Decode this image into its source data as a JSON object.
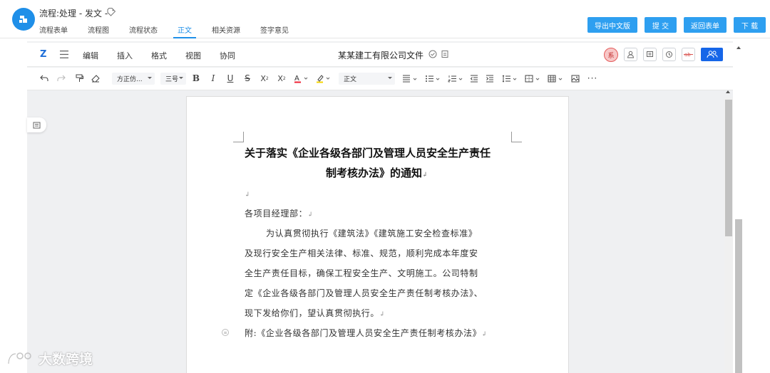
{
  "app": {
    "title": "流程:处理 - 发文 -",
    "tabs": [
      {
        "label": "流程表单",
        "active": false
      },
      {
        "label": "流程图",
        "active": false
      },
      {
        "label": "流程状态",
        "active": false
      },
      {
        "label": "正文",
        "active": true
      },
      {
        "label": "相关资源",
        "active": false
      },
      {
        "label": "签字意见",
        "active": false
      }
    ],
    "buttons": {
      "export": "导出中文版",
      "submit": "提 交",
      "back": "返回表单",
      "download": "下 载"
    },
    "accent_color": "#1f8fe8",
    "button_color": "#2e9ff0"
  },
  "editor": {
    "menu": [
      "编辑",
      "插入",
      "格式",
      "视图",
      "协同"
    ],
    "doc_title": "某某建工有限公司文件",
    "user_avatar": "系",
    "toolbar": {
      "font_family": "方正仿...",
      "font_size": "三号",
      "paragraph_style": "正文",
      "icons": [
        "undo-icon",
        "redo-icon",
        "format-painter-icon",
        "clear-format-icon",
        "bold-icon",
        "italic-icon",
        "underline-icon",
        "strikethrough-icon",
        "superscript-icon",
        "subscript-icon",
        "font-color-icon",
        "highlight-icon",
        "align-icon",
        "bullet-list-icon",
        "numbered-list-icon",
        "outdent-icon",
        "indent-icon",
        "line-spacing-icon",
        "border-icon",
        "table-icon",
        "image-icon",
        "more-icon"
      ]
    }
  },
  "document": {
    "heading_line1": "关于落实《企业各级各部门及管理人员安全生产责任",
    "heading_line2": "制考核办法》的通知",
    "salutation": "各项目经理部：",
    "body_lines": [
      "为认真贯彻执行《建筑法》《建筑施工安全检查标准》",
      "及现行安全生产相关法律、标准、规范，顺利完成本年度安",
      "全生产责任目标，确保工程安全生产、文明施工。公司特制",
      "定《企业各级各部门及管理人员安全生产责任制考核办法》、",
      "现下发给你们，望认真贯彻执行。"
    ],
    "attachment": "附:《企业各级各部门及管理人员安全生产责任制考核办法》",
    "paragraph_mark": "↲"
  },
  "watermark": "大数跨境"
}
